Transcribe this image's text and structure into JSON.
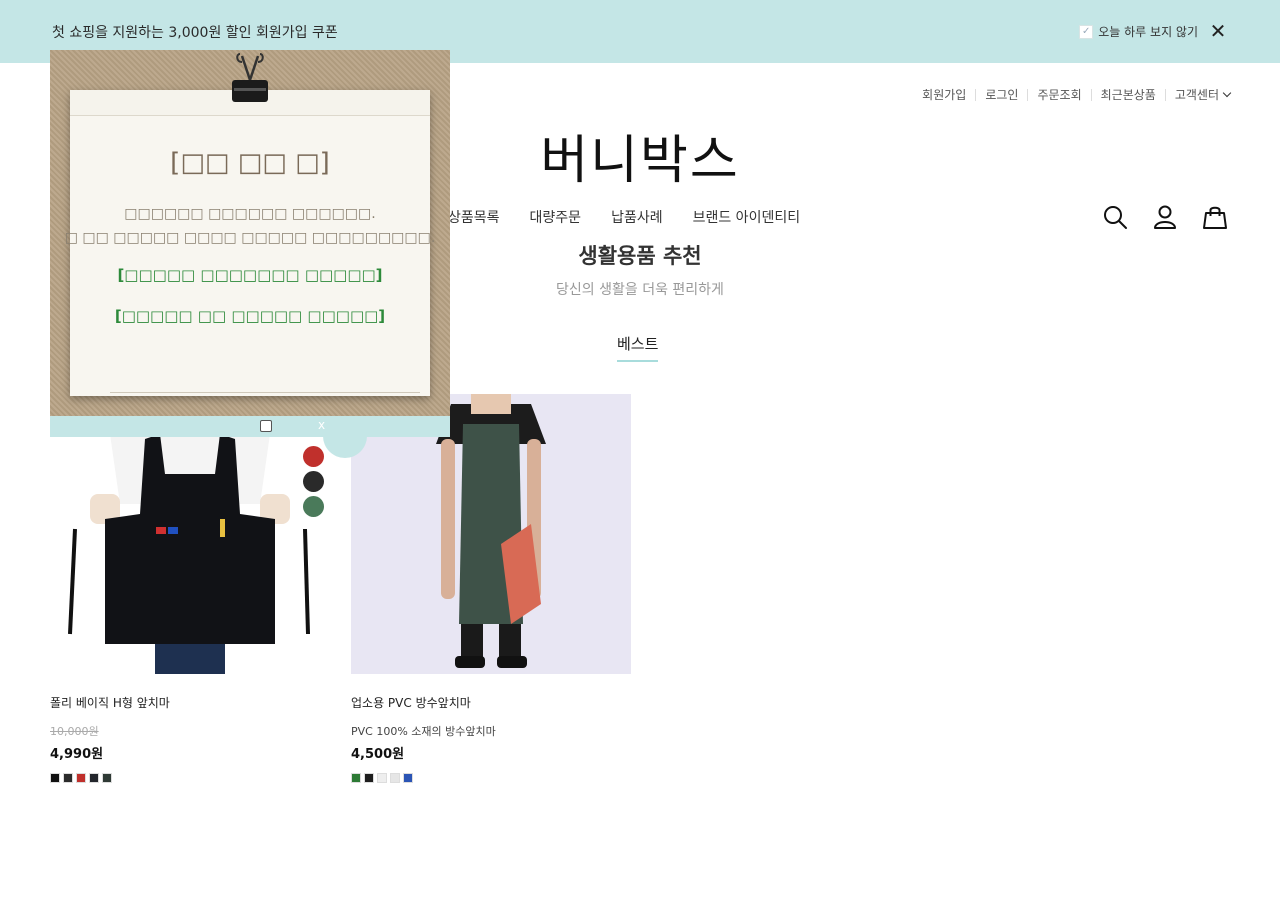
{
  "topbar": {
    "text": "첫 쇼핑을 지원하는 3,000원 할인 회원가입 쿠폰",
    "dismiss_label": "오늘 하루 보지 않기"
  },
  "util_nav": {
    "items": [
      "회원가입",
      "로그인",
      "주문조회",
      "최근본상품"
    ],
    "customer_center": "고객센터"
  },
  "logo": "버니박스",
  "main_nav": {
    "items": [
      "상품목록",
      "대량주문",
      "납품사례",
      "브랜드 아이덴티티"
    ]
  },
  "section": {
    "title": "생활용품 추천",
    "subtitle": "당신의 생활을 더욱 편리하게",
    "tab": "베스트"
  },
  "popup": {
    "title": "[□□ □□ □]",
    "message_line1": "□□□□□□ □□□□□□ □□□□□□.",
    "message_line2": "□ □□ □□□□□ □□□□ □□□□□ □□□□□□□□□.",
    "link1": "[□□□□□ □□□□□□□ □□□□□]",
    "link2": "[□□□□□ □□ □□□□□ □□□□□]",
    "close_label": "x"
  },
  "products": [
    {
      "name": "폴리 베이직 H형 앞치마",
      "original_price": "10,000원",
      "price": "4,990원",
      "description": "",
      "swatches": [
        "#111111",
        "#2b2b2b",
        "#c0302c",
        "#23262c",
        "#2f3a35"
      ],
      "color_dots": [
        "#c0302c",
        "#2a2a2a",
        "#4a7a5a"
      ]
    },
    {
      "name": "업소용 PVC 방수앞치마",
      "original_price": "",
      "price": "4,500원",
      "description": "PVC 100% 소재의 방수앞치마",
      "swatches": [
        "#2d7a35",
        "#1e1e1e",
        "#eeeeee",
        "#e6e6e6",
        "#2b55b5"
      ],
      "color_dots": []
    }
  ]
}
